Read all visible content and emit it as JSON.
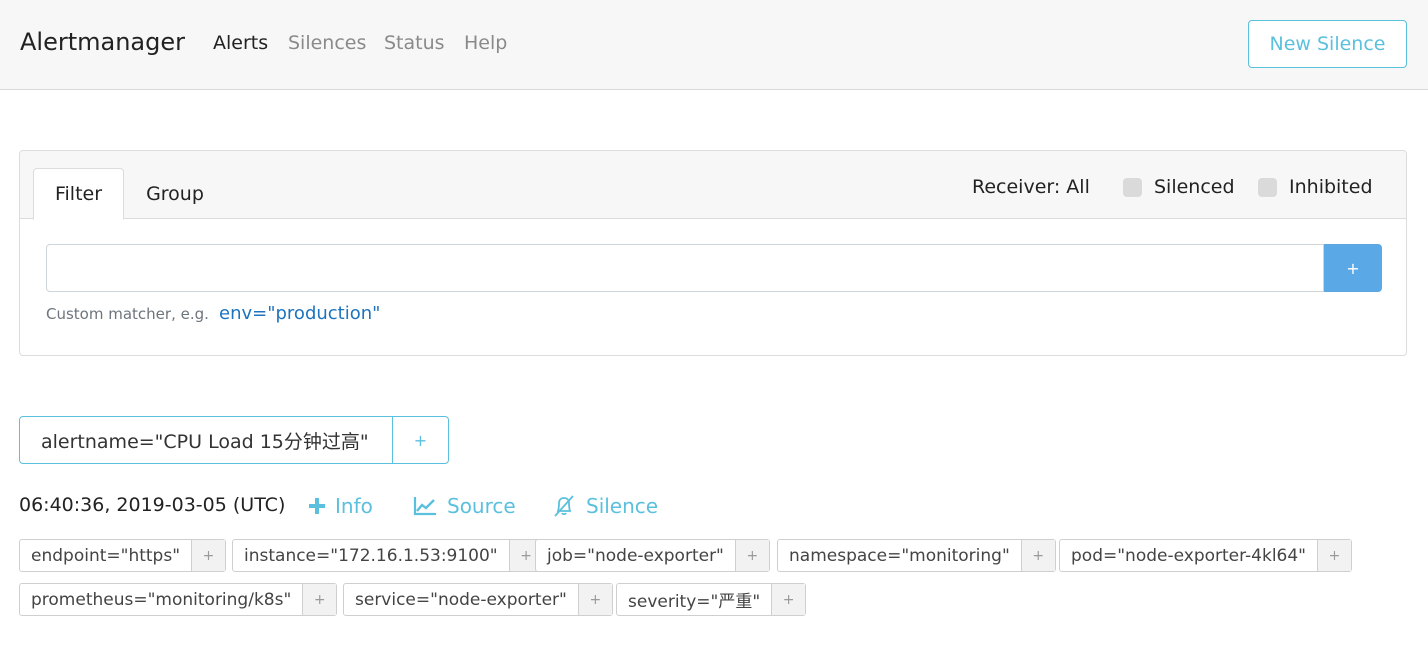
{
  "navbar": {
    "brand": "Alertmanager",
    "links": [
      "Alerts",
      "Silences",
      "Status",
      "Help"
    ],
    "active": "Alerts",
    "new_silence_label": "New Silence"
  },
  "filter_card": {
    "tabs": [
      "Filter",
      "Group"
    ],
    "active_tab": "Filter",
    "receiver_label": "Receiver: All",
    "silenced_label": "Silenced",
    "inhibited_label": "Inhibited",
    "input_value": "",
    "add_button": "+",
    "hint_text": "Custom matcher, e.g.",
    "hint_example": "env=\"production\""
  },
  "group": {
    "label": "alertname=\"CPU Load 15分钟过高\"",
    "add": "+"
  },
  "alert": {
    "timestamp": "06:40:36, 2019-03-05 (UTC)",
    "info_label": "Info",
    "source_label": "Source",
    "silence_label": "Silence",
    "labels": [
      "endpoint=\"https\"",
      "instance=\"172.16.1.53:9100\"",
      "job=\"node-exporter\"",
      "namespace=\"monitoring\"",
      "pod=\"node-exporter-4kl64\"",
      "prometheus=\"monitoring/k8s\"",
      "service=\"node-exporter\"",
      "severity=\"严重\""
    ],
    "label_add": "+"
  },
  "colors": {
    "accent": "#5bc0de",
    "primary_button": "#5ba8e6",
    "link": "#1e73be",
    "navbar_bg": "#f7f7f7"
  }
}
